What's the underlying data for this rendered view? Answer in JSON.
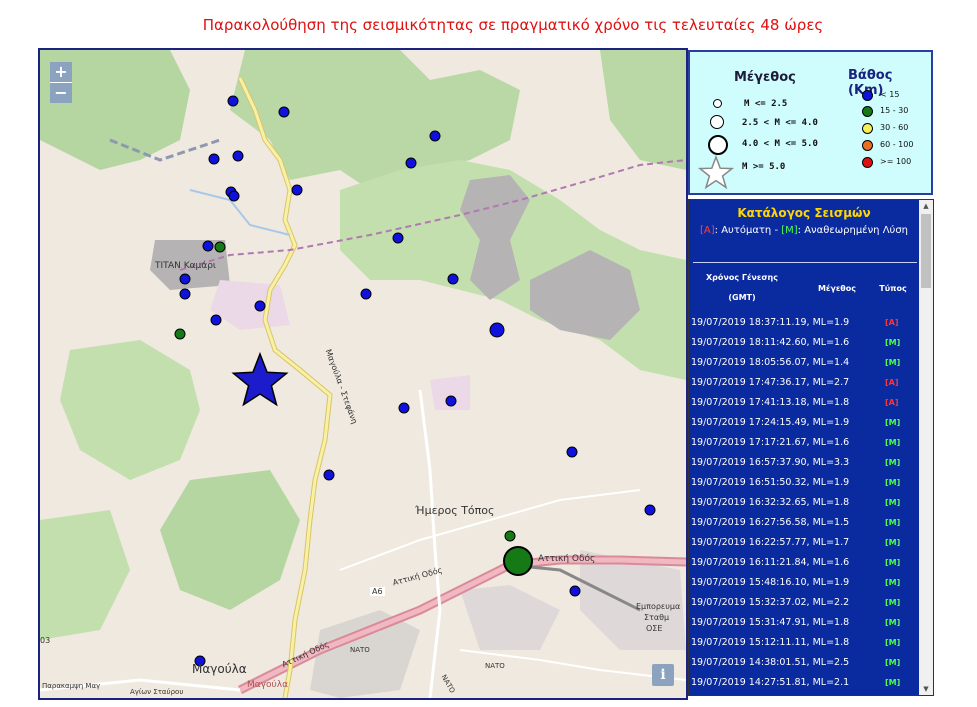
{
  "title": "Παρακολούθηση της σεισμικότητας σε πραγματικό χρόνο τις τελευταίες 48 ώρες",
  "map": {
    "zoom_in": "+",
    "zoom_out": "−",
    "info": "i",
    "labels": {
      "titan": "TITAN Καμάρι",
      "imeros": "Ήμερος Τόπος",
      "magoula": "Μαγούλα",
      "magoula2": "Μαγούλα",
      "attiki_odos": "Αττική Οδός",
      "attiki_odos2": "Αττική Οδός",
      "attiki_odos3": "Αττική Οδός",
      "a6": "A6",
      "nato": "ΝΑΤΟ",
      "nato2": "ΝΑΤΟ",
      "nato3": "ΝΑΤΟ",
      "magoula_steferi": "Μαγούλα - Στεφάνη",
      "emporeuma": "Εμπορευμα",
      "stathmos": "Σταθμ",
      "ose": "ΟΣΕ",
      "paraka": "Παρακαμψη Μαγ",
      "agioi": "Αγίων Σταύρου",
      "num03": "03"
    },
    "colors": {
      "depth_lt15": "#1111dd",
      "depth_15_30": "#157a15",
      "star": "#1c1ccc"
    },
    "events": [
      {
        "mag_class": "small",
        "depth_class": "lt15"
      },
      {
        "mag_class": "small",
        "depth_class": "lt15"
      },
      {
        "mag_class": "small",
        "depth_class": "lt15"
      },
      {
        "mag_class": "small",
        "depth_class": "lt15"
      },
      {
        "mag_class": "small",
        "depth_class": "lt15"
      },
      {
        "mag_class": "small",
        "depth_class": "lt15"
      },
      {
        "mag_class": "small",
        "depth_class": "lt15"
      },
      {
        "mag_class": "small",
        "depth_class": "lt15"
      },
      {
        "mag_class": "small",
        "depth_class": "lt15"
      },
      {
        "mag_class": "small",
        "depth_class": "lt15"
      },
      {
        "mag_class": "small",
        "depth_class": "15_30"
      },
      {
        "mag_class": "small",
        "depth_class": "lt15"
      },
      {
        "mag_class": "small",
        "depth_class": "lt15"
      },
      {
        "mag_class": "small",
        "depth_class": "lt15"
      },
      {
        "mag_class": "small",
        "depth_class": "lt15"
      },
      {
        "mag_class": "small",
        "depth_class": "lt15"
      },
      {
        "mag_class": "small",
        "depth_class": "lt15"
      },
      {
        "mag_class": "small",
        "depth_class": "lt15"
      },
      {
        "mag_class": "small",
        "depth_class": "15_30"
      },
      {
        "mag_class": "medium",
        "depth_class": "lt15"
      },
      {
        "mag_class": "star",
        "depth_class": "lt15"
      },
      {
        "mag_class": "small",
        "depth_class": "lt15"
      },
      {
        "mag_class": "small",
        "depth_class": "lt15"
      },
      {
        "mag_class": "small",
        "depth_class": "lt15"
      },
      {
        "mag_class": "small",
        "depth_class": "lt15"
      },
      {
        "mag_class": "small",
        "depth_class": "lt15"
      },
      {
        "mag_class": "small",
        "depth_class": "15_30"
      },
      {
        "mag_class": "large",
        "depth_class": "15_30"
      },
      {
        "mag_class": "small",
        "depth_class": "lt15"
      },
      {
        "mag_class": "small",
        "depth_class": "lt15"
      }
    ]
  },
  "legend": {
    "magnitude_title": "Μέγεθος",
    "depth_title": "Βάθος (Km)",
    "magnitudes": [
      "M <= 2.5",
      "2.5 < M <= 4.0",
      "4.0 < M <= 5.0",
      "M >= 5.0"
    ],
    "depths": [
      {
        "label": "< 15",
        "color": "#1111dd"
      },
      {
        "label": "15 - 30",
        "color": "#157a15"
      },
      {
        "label": "30 - 60",
        "color": "#f5f05a"
      },
      {
        "label": "60 - 100",
        "color": "#e87020"
      },
      {
        "label": ">= 100",
        "color": "#dd1111"
      }
    ]
  },
  "catalog": {
    "title": "Κατάλογος Σεισμών",
    "sub_a": "[A]",
    "sub_a_text": ": Αυτόματη - ",
    "sub_m": "[M]",
    "sub_m_text": ": Αναθεωρημένη Λύση",
    "col_time": "Χρόνος Γένεσης",
    "col_time2": "(GMT)",
    "col_mag": "Μέγεθος",
    "col_type": "Τύπος",
    "rows": [
      {
        "text": "19/07/2019 18:37:11.19, ML=1.9",
        "type": "[A]",
        "cls": "A"
      },
      {
        "text": "19/07/2019 18:11:42.60, ML=1.6",
        "type": "[M]",
        "cls": "M"
      },
      {
        "text": "19/07/2019 18:05:56.07, ML=1.4",
        "type": "[M]",
        "cls": "M"
      },
      {
        "text": "19/07/2019 17:47:36.17, ML=2.7",
        "type": "[A]",
        "cls": "A"
      },
      {
        "text": "19/07/2019 17:41:13.18, ML=1.8",
        "type": "[A]",
        "cls": "A"
      },
      {
        "text": "19/07/2019 17:24:15.49, ML=1.9",
        "type": "[M]",
        "cls": "M"
      },
      {
        "text": "19/07/2019 17:17:21.67, ML=1.6",
        "type": "[M]",
        "cls": "M"
      },
      {
        "text": "19/07/2019 16:57:37.90, ML=3.3",
        "type": "[M]",
        "cls": "M"
      },
      {
        "text": "19/07/2019 16:51:50.32, ML=1.9",
        "type": "[M]",
        "cls": "M"
      },
      {
        "text": "19/07/2019 16:32:32.65, ML=1.8",
        "type": "[M]",
        "cls": "M"
      },
      {
        "text": "19/07/2019 16:27:56.58, ML=1.5",
        "type": "[M]",
        "cls": "M"
      },
      {
        "text": "19/07/2019 16:22:57.77, ML=1.7",
        "type": "[M]",
        "cls": "M"
      },
      {
        "text": "19/07/2019 16:11:21.84, ML=1.6",
        "type": "[M]",
        "cls": "M"
      },
      {
        "text": "19/07/2019 15:48:16.10, ML=1.9",
        "type": "[M]",
        "cls": "M"
      },
      {
        "text": "19/07/2019 15:32:37.02, ML=2.2",
        "type": "[M]",
        "cls": "M"
      },
      {
        "text": "19/07/2019 15:31:47.91, ML=1.8",
        "type": "[M]",
        "cls": "M"
      },
      {
        "text": "19/07/2019 15:12:11.11, ML=1.8",
        "type": "[M]",
        "cls": "M"
      },
      {
        "text": "19/07/2019 14:38:01.51, ML=2.5",
        "type": "[M]",
        "cls": "M"
      },
      {
        "text": "19/07/2019 14:27:51.81, ML=2.1",
        "type": "[M]",
        "cls": "M"
      }
    ]
  }
}
